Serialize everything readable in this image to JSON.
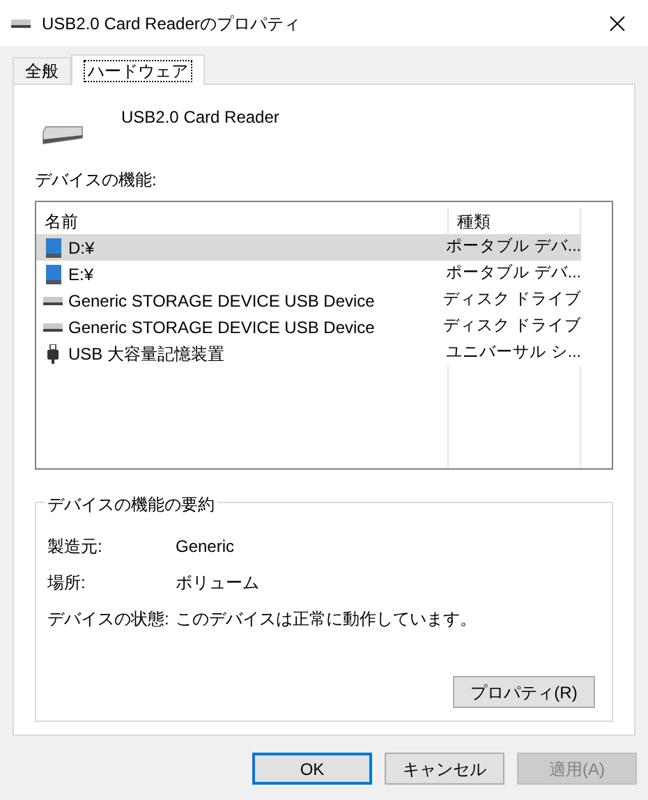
{
  "window": {
    "title": "USB2.0 Card Readerのプロパティ"
  },
  "tabs": [
    {
      "label": "全般",
      "selected": false
    },
    {
      "label": "ハードウェア",
      "selected": true
    }
  ],
  "device": {
    "name": "USB2.0 Card Reader"
  },
  "functions": {
    "label": "デバイスの機能:",
    "columns": [
      "名前",
      "種類"
    ],
    "rows": [
      {
        "kind": "volume",
        "name": "D:¥",
        "type": "ポータブル デバ...",
        "selected": true
      },
      {
        "kind": "volume",
        "name": "E:¥",
        "type": "ポータブル デバ...",
        "selected": false
      },
      {
        "kind": "disk",
        "name": "Generic STORAGE DEVICE USB Device",
        "type": "ディスク ドライブ",
        "selected": false
      },
      {
        "kind": "disk",
        "name": "Generic STORAGE DEVICE USB Device",
        "type": "ディスク ドライブ",
        "selected": false
      },
      {
        "kind": "usb",
        "name": "USB 大容量記憶装置",
        "type": "ユニバーサル シ...",
        "selected": false
      }
    ]
  },
  "summary": {
    "title": "デバイスの機能の要約",
    "fields": [
      {
        "label": "製造元:",
        "value": "Generic"
      },
      {
        "label": "場所:",
        "value": "ボリューム"
      },
      {
        "label": "デバイスの状態:",
        "value": "このデバイスは正常に動作しています。"
      }
    ],
    "button": "プロパティ(R)"
  },
  "buttons": [
    {
      "label": "OK",
      "default": true,
      "disabled": false
    },
    {
      "label": "キャンセル",
      "default": false,
      "disabled": false
    },
    {
      "label": "適用(A)",
      "default": false,
      "disabled": true
    }
  ]
}
